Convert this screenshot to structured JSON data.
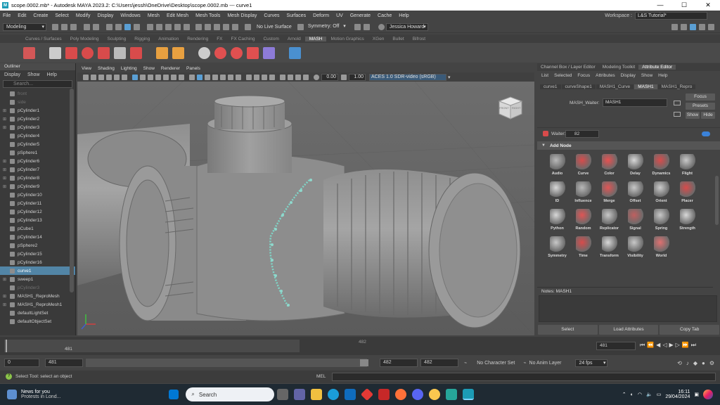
{
  "window": {
    "title": "scope.0002.mb* - Autodesk MAYA 2023.2: C:\\Users\\jessh\\OneDrive\\Desktop\\scope.0002.mb   ---   curve1",
    "logo": "M"
  },
  "menubar": [
    "File",
    "Edit",
    "Create",
    "Select",
    "Modify",
    "Display",
    "Windows",
    "Mesh",
    "Edit Mesh",
    "Mesh Tools",
    "Mesh Display",
    "Curves",
    "Surfaces",
    "Deform",
    "UV",
    "Generate",
    "Cache",
    "Help"
  ],
  "workspace": {
    "label": "Workspace :",
    "value": "L&S Tutorial*"
  },
  "toolbar": {
    "mode": "Modeling",
    "live_surface": "No Live Surface",
    "symmetry": "Symmetry: Off",
    "user": "Jessica Howard"
  },
  "shelf_tabs": [
    "Curves / Surfaces",
    "Poly Modeling",
    "Sculpting",
    "Rigging",
    "Animation",
    "Rendering",
    "FX",
    "FX Caching",
    "Custom",
    "Arnold",
    "MASH",
    "Motion Graphics",
    "XGen",
    "Bullet",
    "Bifrost"
  ],
  "shelf_active": "MASH",
  "outliner": {
    "title": "Outliner",
    "menu": [
      "Display",
      "Show",
      "Help"
    ],
    "search_placeholder": "Search...",
    "items": [
      {
        "label": "front",
        "state": "dim",
        "plus": false
      },
      {
        "label": "side",
        "state": "dim",
        "plus": false
      },
      {
        "label": "pCylinder1",
        "state": "",
        "plus": true
      },
      {
        "label": "pCylinder2",
        "state": "",
        "plus": true
      },
      {
        "label": "pCylinder3",
        "state": "",
        "plus": true
      },
      {
        "label": "pCylinder4",
        "state": "",
        "plus": false
      },
      {
        "label": "pCylinder5",
        "state": "",
        "plus": false
      },
      {
        "label": "pSphere1",
        "state": "",
        "plus": false
      },
      {
        "label": "pCylinder6",
        "state": "",
        "plus": true
      },
      {
        "label": "pCylinder7",
        "state": "",
        "plus": true
      },
      {
        "label": "pCylinder8",
        "state": "",
        "plus": true
      },
      {
        "label": "pCylinder9",
        "state": "",
        "plus": true
      },
      {
        "label": "pCylinder10",
        "state": "",
        "plus": false
      },
      {
        "label": "pCylinder11",
        "state": "",
        "plus": false
      },
      {
        "label": "pCylinder12",
        "state": "",
        "plus": false
      },
      {
        "label": "pCylinder13",
        "state": "",
        "plus": false
      },
      {
        "label": "pCube1",
        "state": "",
        "plus": false
      },
      {
        "label": "pCylinder14",
        "state": "",
        "plus": false
      },
      {
        "label": "pSphere2",
        "state": "",
        "plus": false
      },
      {
        "label": "pCylinder15",
        "state": "",
        "plus": false
      },
      {
        "label": "pCylinder16",
        "state": "",
        "plus": false
      },
      {
        "label": "curve1",
        "state": "sel",
        "plus": false
      },
      {
        "label": "sweep1",
        "state": "",
        "plus": true
      },
      {
        "label": "pCylinder3",
        "state": "dim",
        "plus": false
      },
      {
        "label": "MASH1_ReproMesh",
        "state": "",
        "plus": true
      },
      {
        "label": "MASH1_ReproMesh1",
        "state": "",
        "plus": true
      },
      {
        "label": "defaultLightSet",
        "state": "",
        "plus": false
      },
      {
        "label": "defaultObjectSet",
        "state": "",
        "plus": false
      }
    ]
  },
  "viewport_menu": [
    "View",
    "Shading",
    "Lighting",
    "Show",
    "Renderer",
    "Panels"
  ],
  "viewport_bar": {
    "exposure": "0.00",
    "gamma": "1.00",
    "colorspace": "ACES 1.0 SDR-video (sRGB)"
  },
  "viewcube": {
    "front": "FRONT",
    "right": "RIGHT"
  },
  "right_panel": {
    "tabs": [
      "Channel Box / Layer Editor",
      "Modeling Toolkit",
      "Attribute Editor"
    ],
    "active_tab": "Attribute Editor",
    "menu": [
      "List",
      "Selected",
      "Focus",
      "Attributes",
      "Display",
      "Show",
      "Help"
    ],
    "node_tabs": [
      "curve1",
      "curveShape1",
      "MASH1_Curve",
      "MASH1",
      "MASH1_Repro"
    ],
    "active_node_tab": "MASH1",
    "waiter_label": "MASH_Waiter:",
    "waiter_value": "MASH1",
    "buttons": [
      "Focus",
      "Presets",
      "Show",
      "Hide"
    ],
    "waiter_short_label": "Waiter:",
    "waiter_count": "82",
    "add_node": "Add Node",
    "nodes": [
      {
        "label": "Audio",
        "color": "#b8b8b8"
      },
      {
        "label": "Curve",
        "color": "#d84b4b"
      },
      {
        "label": "Color",
        "color": "#e85050"
      },
      {
        "label": "Delay",
        "color": "#d8d8d8"
      },
      {
        "label": "Dynamics",
        "color": "#d84b4b"
      },
      {
        "label": "Flight",
        "color": "#c8c8c8"
      },
      {
        "label": "ID",
        "color": "#d8d8d8"
      },
      {
        "label": "Influence",
        "color": "#b8b8b8"
      },
      {
        "label": "Merge",
        "color": "#e05555"
      },
      {
        "label": "Offset",
        "color": "#c8c8c8"
      },
      {
        "label": "Orient",
        "color": "#cccccc"
      },
      {
        "label": "Placer",
        "color": "#d84b4b"
      },
      {
        "label": "Python",
        "color": "#d8d8d8"
      },
      {
        "label": "Random",
        "color": "#e05555"
      },
      {
        "label": "Replicator",
        "color": "#c8c8c8"
      },
      {
        "label": "Signal",
        "color": "#c06060"
      },
      {
        "label": "Spring",
        "color": "#c8c8c8"
      },
      {
        "label": "Strength",
        "color": "#d8d8d8"
      },
      {
        "label": "Symmetry",
        "color": "#c8c8c8"
      },
      {
        "label": "Time",
        "color": "#d84b4b"
      },
      {
        "label": "Transform",
        "color": "#d8d8d8"
      },
      {
        "label": "Visibility",
        "color": "#c8c8c8"
      },
      {
        "label": "World",
        "color": "#e07070"
      }
    ],
    "notes_label": "Notes:  MASH1",
    "bottom_buttons": [
      "Select",
      "Load Attributes",
      "Copy Tab"
    ]
  },
  "timeline": {
    "current": "481",
    "middle": "482",
    "end_field": "481"
  },
  "range": {
    "start": "0",
    "start2": "481",
    "end1": "482",
    "end2": "482",
    "char_set": "No Character Set",
    "anim_layer": "No Anim Layer",
    "fps": "24 fps"
  },
  "status": {
    "lang": "MEL",
    "help": "Select Tool: select an object"
  },
  "taskbar": {
    "news_title": "News for you",
    "news_sub": "Protests in Lond...",
    "search": "Search",
    "time": "16:11",
    "date": "29/04/2024"
  }
}
